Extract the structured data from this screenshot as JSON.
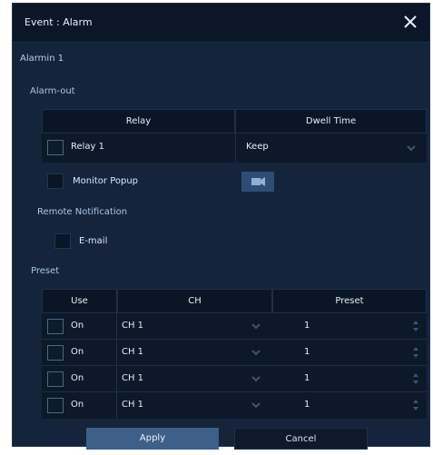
{
  "window": {
    "title": "Event : Alarm",
    "close_icon": "close-icon"
  },
  "alarmin": {
    "label": "Alarmin 1"
  },
  "alarm_out": {
    "section_label": "Alarm-out",
    "columns": [
      "Relay",
      "Dwell Time"
    ],
    "relay": {
      "label": "Relay 1",
      "checked": false
    },
    "dwell_time": {
      "value": "Keep",
      "icon": "chevron-down-icon"
    },
    "monitor_popup": {
      "label": "Monitor Popup",
      "checked": false,
      "icon": "camera-icon"
    }
  },
  "remote_notification": {
    "section_label": "Remote Notification",
    "email": {
      "label": "E-mail",
      "checked": false
    }
  },
  "preset": {
    "section_label": "Preset",
    "columns": [
      "Use",
      "CH",
      "Preset"
    ],
    "rows": [
      {
        "use": "On",
        "ch": "CH 1",
        "preset": "1"
      },
      {
        "use": "On",
        "ch": "CH 1",
        "preset": "1"
      },
      {
        "use": "On",
        "ch": "CH 1",
        "preset": "1"
      },
      {
        "use": "On",
        "ch": "CH 1",
        "preset": "1"
      }
    ]
  },
  "buttons": {
    "apply": "Apply",
    "cancel": "Cancel"
  },
  "colors": {
    "dialog_bg": "#14243a",
    "header_bg": "#0a1626",
    "apply_bg": "#3e5f88",
    "cancel_bg": "#0d1a2b"
  }
}
